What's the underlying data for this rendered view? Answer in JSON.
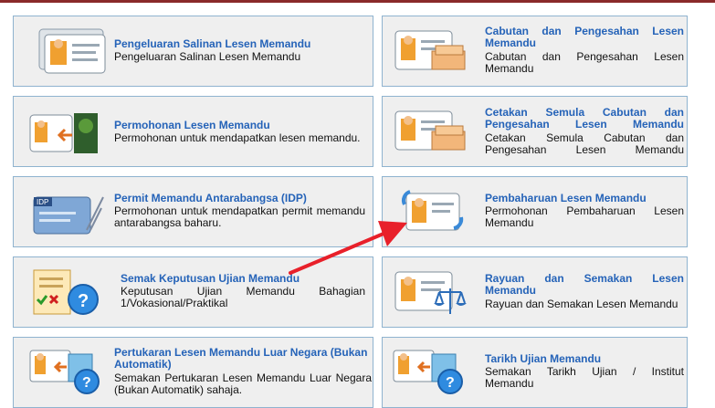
{
  "cards": [
    {
      "title": "Pengeluaran Salinan Lesen Memandu",
      "desc": "Pengeluaran Salinan Lesen Memandu",
      "icon": "license-copy-icon"
    },
    {
      "title": "Cabutan dan Pengesahan Lesen Memandu",
      "desc": "Cabutan dan Pengesahan Lesen Memandu",
      "icon": "license-extract-icon"
    },
    {
      "title": "Permohonan Lesen Memandu",
      "desc": "Permohonan untuk mendapatkan lesen memandu.",
      "icon": "license-apply-icon"
    },
    {
      "title": "Cetakan Semula Cabutan dan Pengesahan Lesen Memandu",
      "desc": "Cetakan Semula Cabutan dan Pengesahan Lesen Memandu",
      "icon": "license-reprint-icon"
    },
    {
      "title": "Permit Memandu Antarabangsa (IDP)",
      "desc": "Permohonan untuk mendapatkan permit memandu antarabangsa baharu.",
      "icon": "idp-card-icon",
      "icon_text": "IDP"
    },
    {
      "title": "Pembaharuan Lesen Memandu",
      "desc": "Permohonan Pembaharuan Lesen Memandu",
      "icon": "license-renewal-icon"
    },
    {
      "title": "Semak Keputusan Ujian Memandu",
      "desc": "Keputusan Ujian Memandu Bahagian 1/Vokasional/Praktikal",
      "icon": "test-result-check-icon"
    },
    {
      "title": "Rayuan dan Semakan Lesen Memandu",
      "desc": "Rayuan dan Semakan Lesen Memandu",
      "icon": "appeal-scale-icon"
    },
    {
      "title": "Pertukaran Lesen Memandu Luar Negara (Bukan Automatik)",
      "desc": "Semakan Pertukaran Lesen Memandu Luar Negara (Bukan Automatik) sahaja.",
      "icon": "foreign-license-exchange-icon"
    },
    {
      "title": "Tarikh Ujian Memandu",
      "desc": "Semakan Tarikh Ujian / Institut Memandu",
      "icon": "test-date-check-icon"
    }
  ],
  "colors": {
    "title": "#2563b8",
    "border": "#8fb3cf",
    "card_bg": "#efefef",
    "arrow": "#e8202a"
  },
  "annotation": "red-pointer-arrow"
}
